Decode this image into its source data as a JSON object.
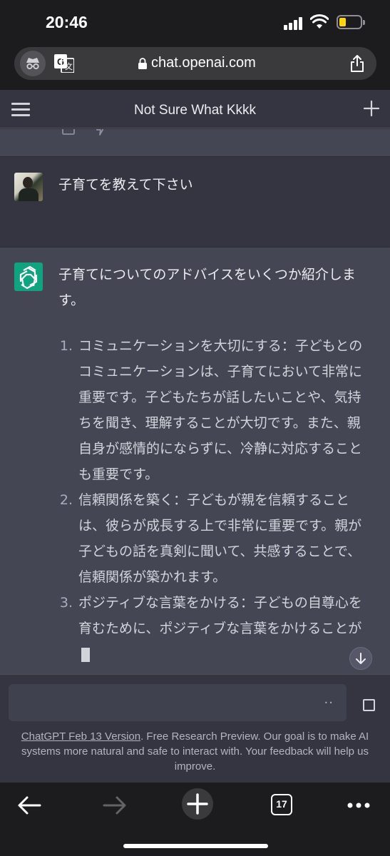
{
  "status_bar": {
    "time": "20:46"
  },
  "browser": {
    "url": "chat.openai.com",
    "tab_count": "17"
  },
  "chat": {
    "title": "Not Sure What Kkkk",
    "user_message": "子育てを教えて下さい",
    "assistant_intro": "子育てについてのアドバイスをいくつか紹介します。",
    "assistant_items": [
      {
        "num": "1.",
        "text": "コミュニケーションを大切にする：子どもとのコミュニケーションは、子育てにおいて非常に重要です。子どもたちが話したいことや、気持ちを聞き、理解することが大切です。また、親自身が感情的にならずに、冷静に対応することも重要です。"
      },
      {
        "num": "2.",
        "text": "信頼関係を築く：子どもが親を信頼することは、彼らが成長する上で非常に重要です。親が子どもの話を真剣に聞いて、共感することで、信頼関係が築かれます。"
      },
      {
        "num": "3.",
        "text": "ポジティブな言葉をかける：子どもの自尊心を育むために、ポジティブな言葉をかけることが"
      }
    ]
  },
  "composer": {
    "typing_indicator": "··",
    "footer_link": "ChatGPT Feb 13 Version",
    "footer_text": ". Free Research Preview. Our goal is to make AI systems more natural and safe to interact with. Your feedback will help us improve."
  },
  "colors": {
    "background": "#343541",
    "assistant_bg": "#444654",
    "brand_green": "#10a37f",
    "chrome": "#1c1c1e"
  },
  "icons": [
    "incognito-icon",
    "translate-icon",
    "lock-icon",
    "share-icon",
    "menu-icon",
    "plus-icon",
    "copy-icon",
    "thumbs-down-icon",
    "openai-logo-icon",
    "arrow-down-icon",
    "stop-icon",
    "back-icon",
    "forward-icon",
    "new-tab-icon",
    "tabs-icon",
    "more-icon"
  ]
}
